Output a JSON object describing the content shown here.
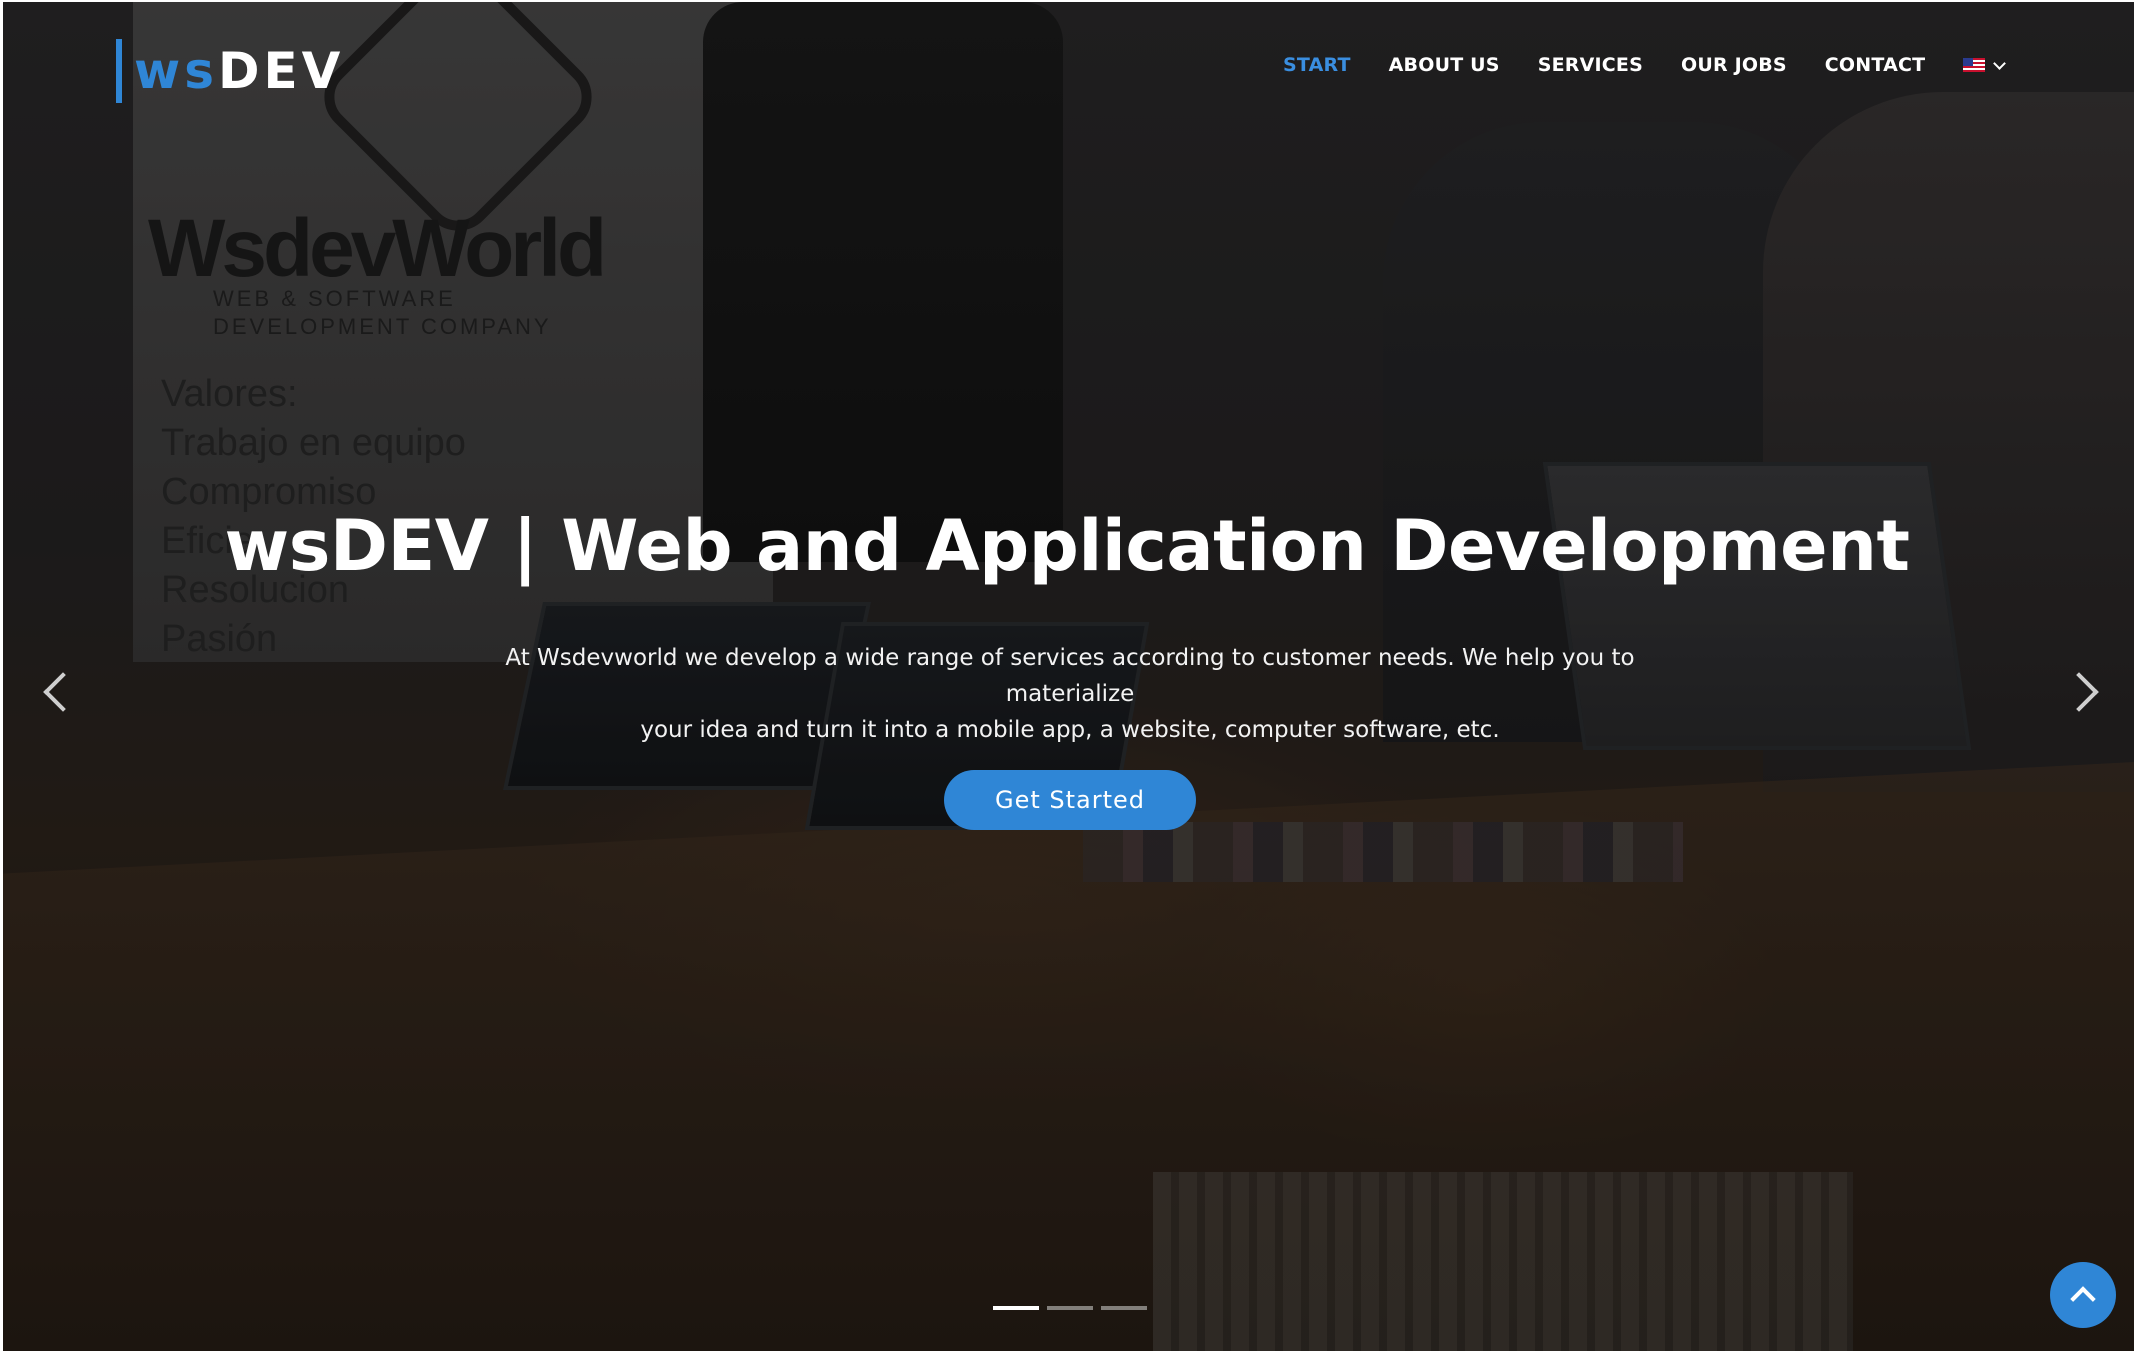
{
  "brand": {
    "prefix": "ws",
    "suffix": "DEV",
    "accent_color": "#2f86d6"
  },
  "nav": {
    "items": [
      {
        "label": "START",
        "active": true
      },
      {
        "label": "ABOUT US",
        "active": false
      },
      {
        "label": "SERVICES",
        "active": false
      },
      {
        "label": "OUR JOBS",
        "active": false
      },
      {
        "label": "CONTACT",
        "active": false
      }
    ],
    "language": {
      "icon": "us-flag-icon"
    }
  },
  "background_scene": {
    "whiteboard_brand": "WsdevWorld",
    "whiteboard_tagline_1": "WEB & SOFTWARE",
    "whiteboard_tagline_2": "DEVELOPMENT COMPANY",
    "whiteboard_values": [
      "Valores:",
      "Trabajo en equipo",
      "Compromiso",
      "Eficie",
      "Resolucion",
      "Pasión"
    ]
  },
  "hero": {
    "title": "wsDEV | Web and Application Development",
    "description_line1": "At Wsdevworld we develop a wide range of services according to customer needs. We help you to materialize",
    "description_line2": "your idea and turn it into a mobile app, a website, computer software, etc.",
    "cta_label": "Get Started"
  },
  "carousel": {
    "slide_count": 3,
    "active_index": 0,
    "prev_icon": "chevron-left-icon",
    "next_icon": "chevron-right-icon"
  },
  "back_to_top": {
    "icon": "chevron-up-icon"
  }
}
